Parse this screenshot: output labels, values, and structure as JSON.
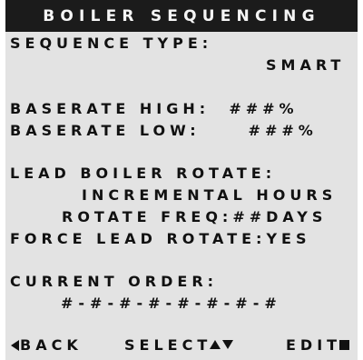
{
  "header": {
    "title": "BOILER SEQUENCING"
  },
  "settings": {
    "sequence_type_label": "SEQUENCE TYPE:",
    "sequence_type_value": "SMART",
    "baserate_high_label": "BASERATE HIGH:",
    "baserate_high_value": "###%",
    "baserate_low_label": "BASERATE LOW:",
    "baserate_low_value": "###%",
    "lead_rotate_label": "LEAD BOILER ROTATE:",
    "lead_rotate_value": "INCREMENTAL HOURS",
    "rotate_freq_label": "ROTATE FREQ:",
    "rotate_freq_value": "##DAYS",
    "force_lead_label": "FORCE LEAD ROTATE:",
    "force_lead_value": "YES",
    "current_order_label": "CURRENT ORDER:",
    "current_order_value": "#-#-#-#-#-#-#-#"
  },
  "softkeys": {
    "back_label": "BACK",
    "select_label": "SELECT",
    "edit_label": "EDIT"
  },
  "icons": {
    "back": "triangle-left-icon",
    "select_up": "triangle-up-icon",
    "select_down": "triangle-down-icon",
    "edit": "square-icon"
  },
  "colors": {
    "screen_bg": "#e3e3e3",
    "title_bg": "#1b1b1b",
    "title_text": "#f5f5f5",
    "text": "#111111"
  }
}
